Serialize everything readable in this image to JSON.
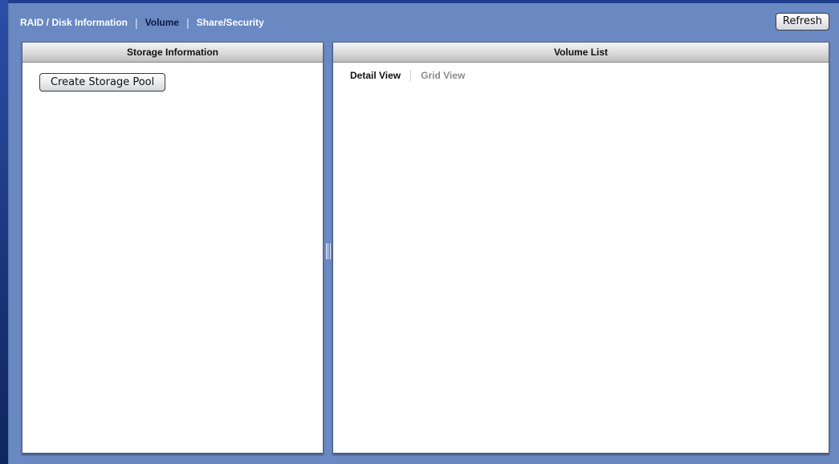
{
  "nav": {
    "tabs": [
      {
        "label": "RAID / Disk Information",
        "active": false
      },
      {
        "label": "Volume",
        "active": true
      },
      {
        "label": "Share/Security",
        "active": false
      }
    ],
    "separator": "|"
  },
  "toolbar": {
    "refresh_label": "Refresh"
  },
  "storage_panel": {
    "title": "Storage Information",
    "create_pool_label": "Create Storage Pool"
  },
  "volume_panel": {
    "title": "Volume List",
    "views": [
      {
        "label": "Detail View",
        "active": true
      },
      {
        "label": "Grid View",
        "active": false
      }
    ]
  },
  "colors": {
    "app_background": "#6a88c2",
    "panel_background": "#ffffff",
    "active_tab_text": "#0b1a40",
    "inactive_view_text": "#8c8c8c"
  }
}
